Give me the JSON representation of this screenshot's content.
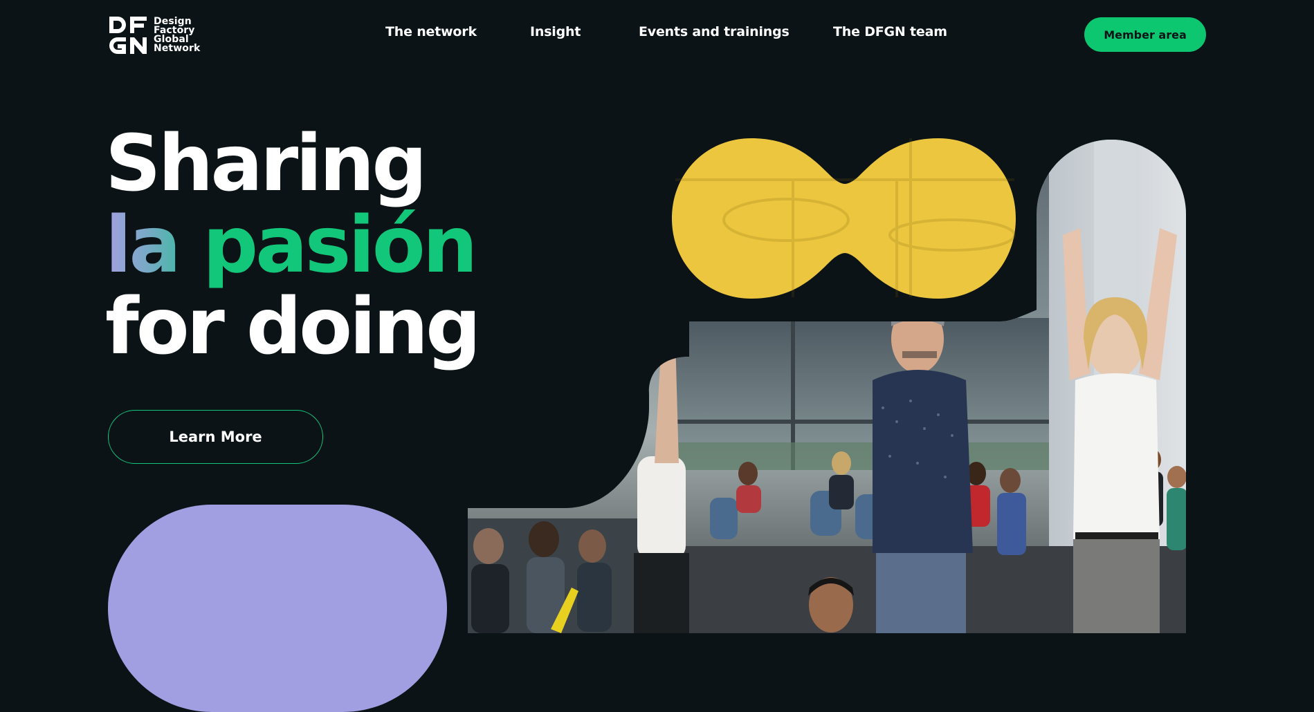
{
  "header": {
    "logo_mark": "DFGN",
    "logo_lines": [
      "Design",
      "Factory",
      "Global",
      "Network"
    ],
    "nav": [
      {
        "label": "The network"
      },
      {
        "label": "Insight"
      },
      {
        "label": "Events and trainings"
      },
      {
        "label": "The DFGN team"
      }
    ],
    "member_button": "Member area"
  },
  "hero": {
    "line1": "Sharing",
    "line2_gradient": "la",
    "line2_rest": " pasión",
    "line3": "for doing",
    "cta_label": "Learn More"
  },
  "colors": {
    "background": "#0b1316",
    "accent_green": "#0cc770",
    "lavender": "#a19fe1",
    "yellow": "#ecc63e"
  },
  "images": {
    "collage": "photo-of-workshop-participants-raising-arms"
  }
}
